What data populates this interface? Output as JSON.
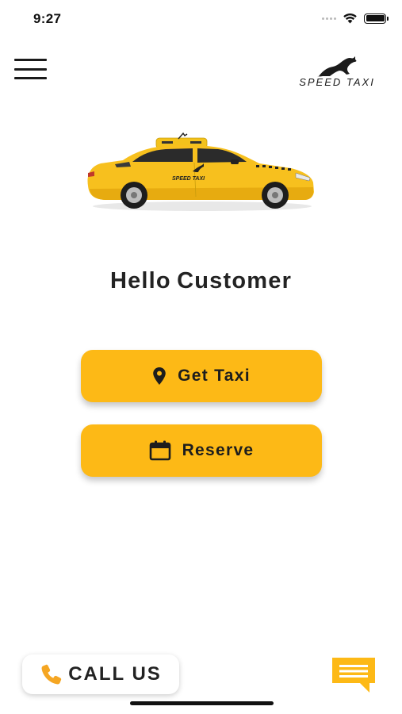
{
  "status_bar": {
    "time": "9:27",
    "icons": [
      "signal-dots-icon",
      "wifi-icon",
      "battery-icon"
    ]
  },
  "header": {
    "menu_icon": "hamburger-menu-icon",
    "logo_text": "SPEED TAXI"
  },
  "hero": {
    "image": "yellow-taxi-car-illustration",
    "car_door_text": "SPEED TAXI"
  },
  "greeting": "Hello Customer",
  "actions": {
    "get_taxi": {
      "label": "Get Taxi",
      "icon": "location-pin-icon"
    },
    "reserve": {
      "label": "Reserve",
      "icon": "calendar-icon"
    }
  },
  "footer": {
    "call_label": "CALL US",
    "call_icon": "phone-icon",
    "chat_icon": "chat-bubble-icon"
  },
  "colors": {
    "accent": "#fdb916",
    "text": "#232323",
    "background": "#ffffff"
  }
}
